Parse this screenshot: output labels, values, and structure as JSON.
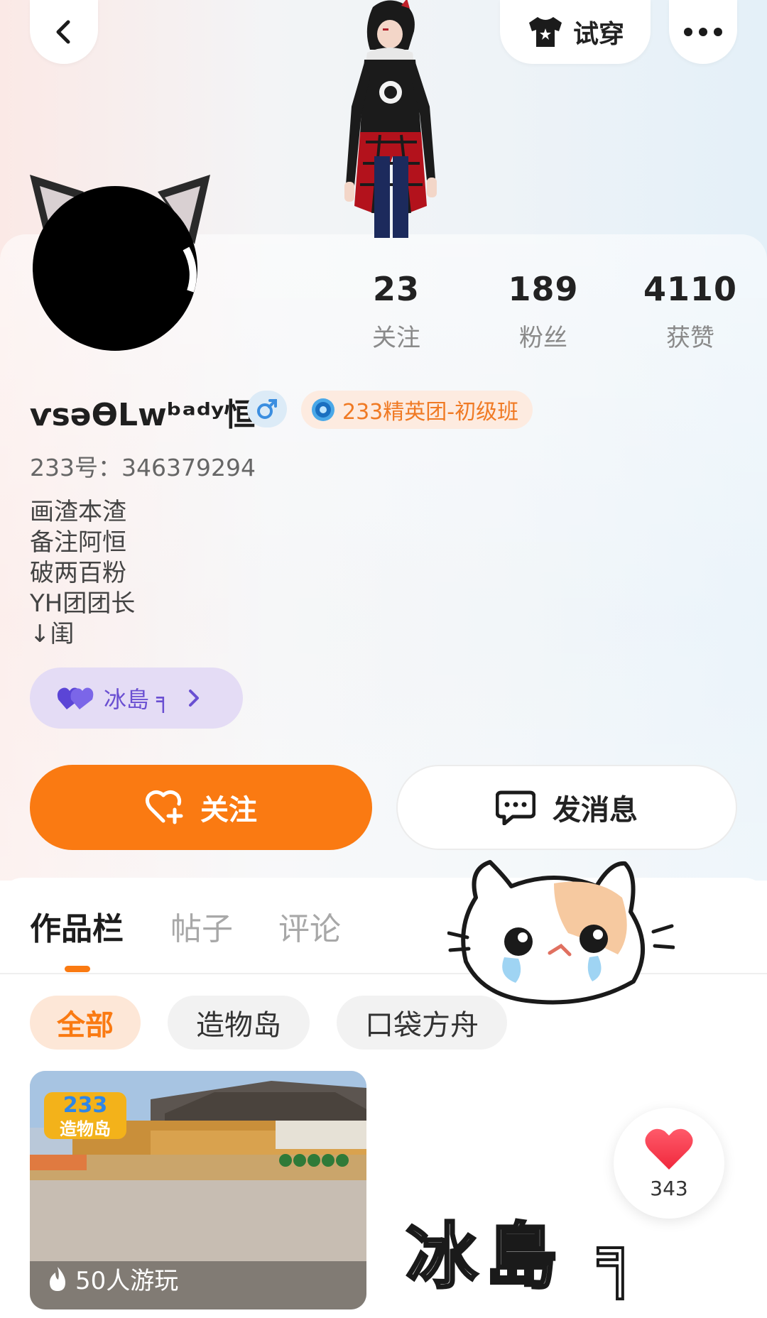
{
  "top_bar": {
    "back_icon": "chevron-left-icon",
    "tryon_label": "试穿",
    "tryon_icon": "tshirt-icon",
    "more_icon": "more-dots-icon"
  },
  "profile": {
    "name": "ѵѕəƟLwᵇᵃᵈʸ恒",
    "gender_icon": "male-icon",
    "group_badge": "233精英团-初级班",
    "uid": "233号：346379294",
    "bio": [
      "画渣本渣",
      "备注阿恒",
      "破两百粉",
      "YH团团长",
      "↓闺"
    ],
    "tag_label": "冰島 ╕",
    "tag_icon": "heart-pair-icon"
  },
  "stats": [
    {
      "value": "23",
      "label": "关注"
    },
    {
      "value": "189",
      "label": "粉丝"
    },
    {
      "value": "4110",
      "label": "获赞"
    }
  ],
  "actions": {
    "follow_label": "关注",
    "message_label": "发消息"
  },
  "tabs": [
    {
      "label": "作品栏",
      "active": true
    },
    {
      "label": "帖子",
      "active": false
    },
    {
      "label": "评论",
      "active": false
    }
  ],
  "filters": [
    {
      "label": "全部",
      "active": true
    },
    {
      "label": "造物岛",
      "active": false
    },
    {
      "label": "口袋方舟",
      "active": false
    }
  ],
  "works": [
    {
      "plays": "50人游玩",
      "logo_line1": "233",
      "logo_line2": "造物岛"
    }
  ],
  "like_fab": {
    "count": "343"
  },
  "sticker_text": "冰島 ╕",
  "colors": {
    "accent": "#fa7a12",
    "tag_purple": "#6a4fd2",
    "badge_orange": "#f07a24"
  }
}
